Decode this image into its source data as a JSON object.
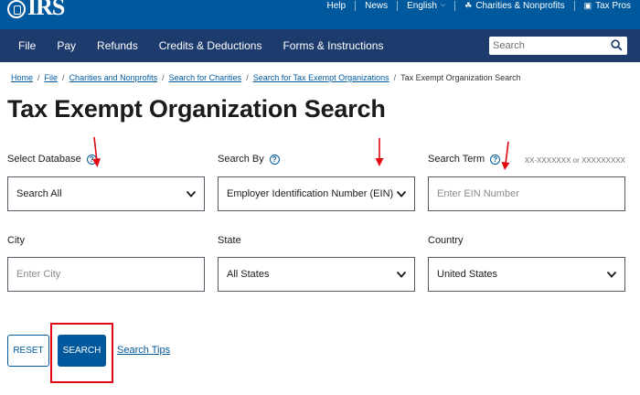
{
  "topbar": {
    "logo_text": "IRS",
    "links": [
      {
        "label": "Help"
      },
      {
        "label": "News"
      },
      {
        "label": "English"
      },
      {
        "label": "Charities & Nonprofits"
      },
      {
        "label": "Tax Pros"
      }
    ]
  },
  "nav": {
    "items": [
      "File",
      "Pay",
      "Refunds",
      "Credits & Deductions",
      "Forms & Instructions"
    ],
    "search_placeholder": "Search"
  },
  "breadcrumb": {
    "links": [
      "Home",
      "File",
      "Charities and Nonprofits",
      "Search for Charities",
      "Search for Tax Exempt Organizations"
    ],
    "current": "Tax Exempt Organization Search"
  },
  "page_title": "Tax Exempt Organization Search",
  "form": {
    "select_database": {
      "label": "Select Database",
      "value": "Search All"
    },
    "search_by": {
      "label": "Search By",
      "value": "Employer Identification Number (EIN)"
    },
    "search_term": {
      "label": "Search Term",
      "hint": "XX-XXXXXXX or XXXXXXXXX",
      "placeholder": "Enter EIN Number"
    },
    "city": {
      "label": "City",
      "placeholder": "Enter City"
    },
    "state": {
      "label": "State",
      "value": "All States"
    },
    "country": {
      "label": "Country",
      "value": "United States"
    }
  },
  "actions": {
    "reset_label": "RESET",
    "search_label": "SEARCH",
    "tips_label": "Search Tips"
  },
  "colors": {
    "top_bar": "#00599c",
    "main_nav": "#1e3b6e",
    "link": "#00599c",
    "annotation": "#e30613"
  }
}
